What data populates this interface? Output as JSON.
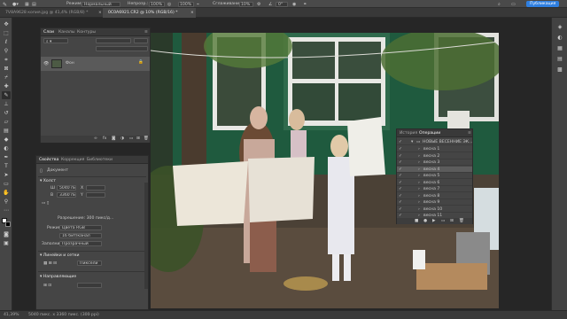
{
  "options_bar": {
    "mode_label": "Режим:",
    "mode_value": "Нормальный",
    "opacity_label": "Непрозр.:",
    "opacity_value": "100%",
    "flow_value": "100%",
    "smoothing_label": "Сглаживание:",
    "smoothing_value": "10%",
    "angle_value": "0°",
    "share_label": "Публикация"
  },
  "doc_tabs": [
    {
      "label": "7V8A9628 копия.jpg @ 41,4% (RGB/8) *"
    },
    {
      "label": "0C0A6921.CR2 @ 10% (RGB/16) *"
    }
  ],
  "layers_panel": {
    "tabs": [
      "Слои",
      "Каналы",
      "Контуры"
    ],
    "layer_name": "Фон"
  },
  "properties_panel": {
    "tabs": [
      "Свойства",
      "Коррекция",
      "Библиотеки"
    ],
    "doc_label": "Документ",
    "canvas_section": "Холст",
    "width_label": "Ш",
    "width_value": "5040 пикс.",
    "height_label": "В",
    "height_value": "3360 пикс.",
    "x_label": "X",
    "y_label": "Y",
    "resolution": "Разрешение: 300 пикс/д...",
    "mode_label": "Режим",
    "mode_value": "Цвета RGB",
    "bits_value": "16 бит/канал",
    "fill_label": "Заполнить",
    "fill_value": "Прозрачный",
    "rulers_section": "Линейки и сетки",
    "units_value": "Пиксели",
    "guides_section": "Направляющие"
  },
  "actions_panel": {
    "tabs": [
      "История",
      "Операции"
    ],
    "set_name": "НОВЫЕ ВЕСЕННИЕ ЭК...",
    "items": [
      "весна 1",
      "весна 2",
      "весна 3",
      "весна 4",
      "весна 5",
      "весна 6",
      "весна 7",
      "весна 8",
      "весна 9",
      "весна 10",
      "весна 11"
    ]
  },
  "status": {
    "zoom": "41,39%",
    "size": "5040 пикс. x 3360 пикс. (300 ppi)"
  },
  "colors": {
    "accent": "#2f7fe0",
    "panel_bg": "#454545",
    "canvas_bg": "#262626"
  }
}
